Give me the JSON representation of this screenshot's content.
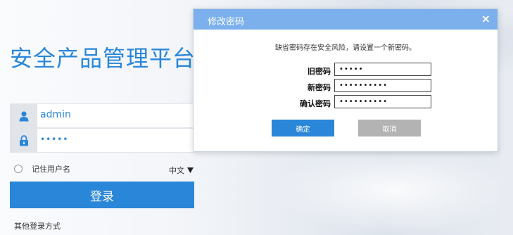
{
  "page": {
    "title": "安全产品管理平台"
  },
  "login": {
    "username": "admin",
    "password_mask": "•••••",
    "remember_label": "记住用户名",
    "language": "中文",
    "login_button": "登录",
    "other_login": "其他登录方式"
  },
  "dialog": {
    "title": "修改密码",
    "close_glyph": "×",
    "message": "缺省密码存在安全风险，请设置一个新密码。",
    "fields": [
      {
        "label": "旧密码",
        "value": "•••••"
      },
      {
        "label": "新密码",
        "value": "••••••••••"
      },
      {
        "label": "确认密码",
        "value": "••••••••••"
      }
    ],
    "confirm_button": "确定",
    "cancel_button": "取消"
  },
  "icons": {
    "user": "user-icon",
    "lock": "lock-icon",
    "dropdown": "caret-down-icon"
  },
  "colors": {
    "accent": "#2a86d8",
    "dialog_header": "#7bb0ec",
    "cancel": "#b3b3b3"
  }
}
